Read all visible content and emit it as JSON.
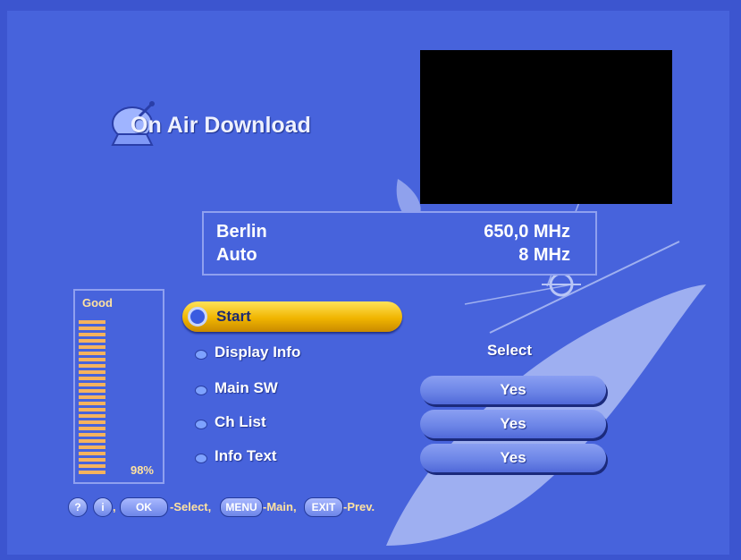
{
  "screen": {
    "title": "On Air Download",
    "title_icon": "satellite-dish-icon",
    "colors": {
      "background": "#4763dc",
      "highlight": "#f0b500",
      "preview": "#000000"
    }
  },
  "info": {
    "location": "Berlin",
    "frequency": "650,0 MHz",
    "mode": "Auto",
    "bandwidth": "8 MHz"
  },
  "signal": {
    "label": "Good",
    "percent_text": "98%",
    "level": 0.98
  },
  "menu": {
    "start_label": "Start",
    "display_info_label": "Display Info",
    "display_info_value": "Select",
    "main_sw_label": "Main SW",
    "main_sw_value": "Yes",
    "ch_list_label": "Ch List",
    "ch_list_value": "Yes",
    "info_text_label": "Info Text",
    "info_text_value": "Yes"
  },
  "footer": {
    "help_icon": "question-icon",
    "info_icon": "info-icon",
    "separator": ",",
    "ok_key": "OK",
    "ok_text": "-Select,",
    "menu_key": "MENU",
    "menu_text": "-Main,",
    "exit_key": "EXIT",
    "exit_text": "-Prev."
  }
}
